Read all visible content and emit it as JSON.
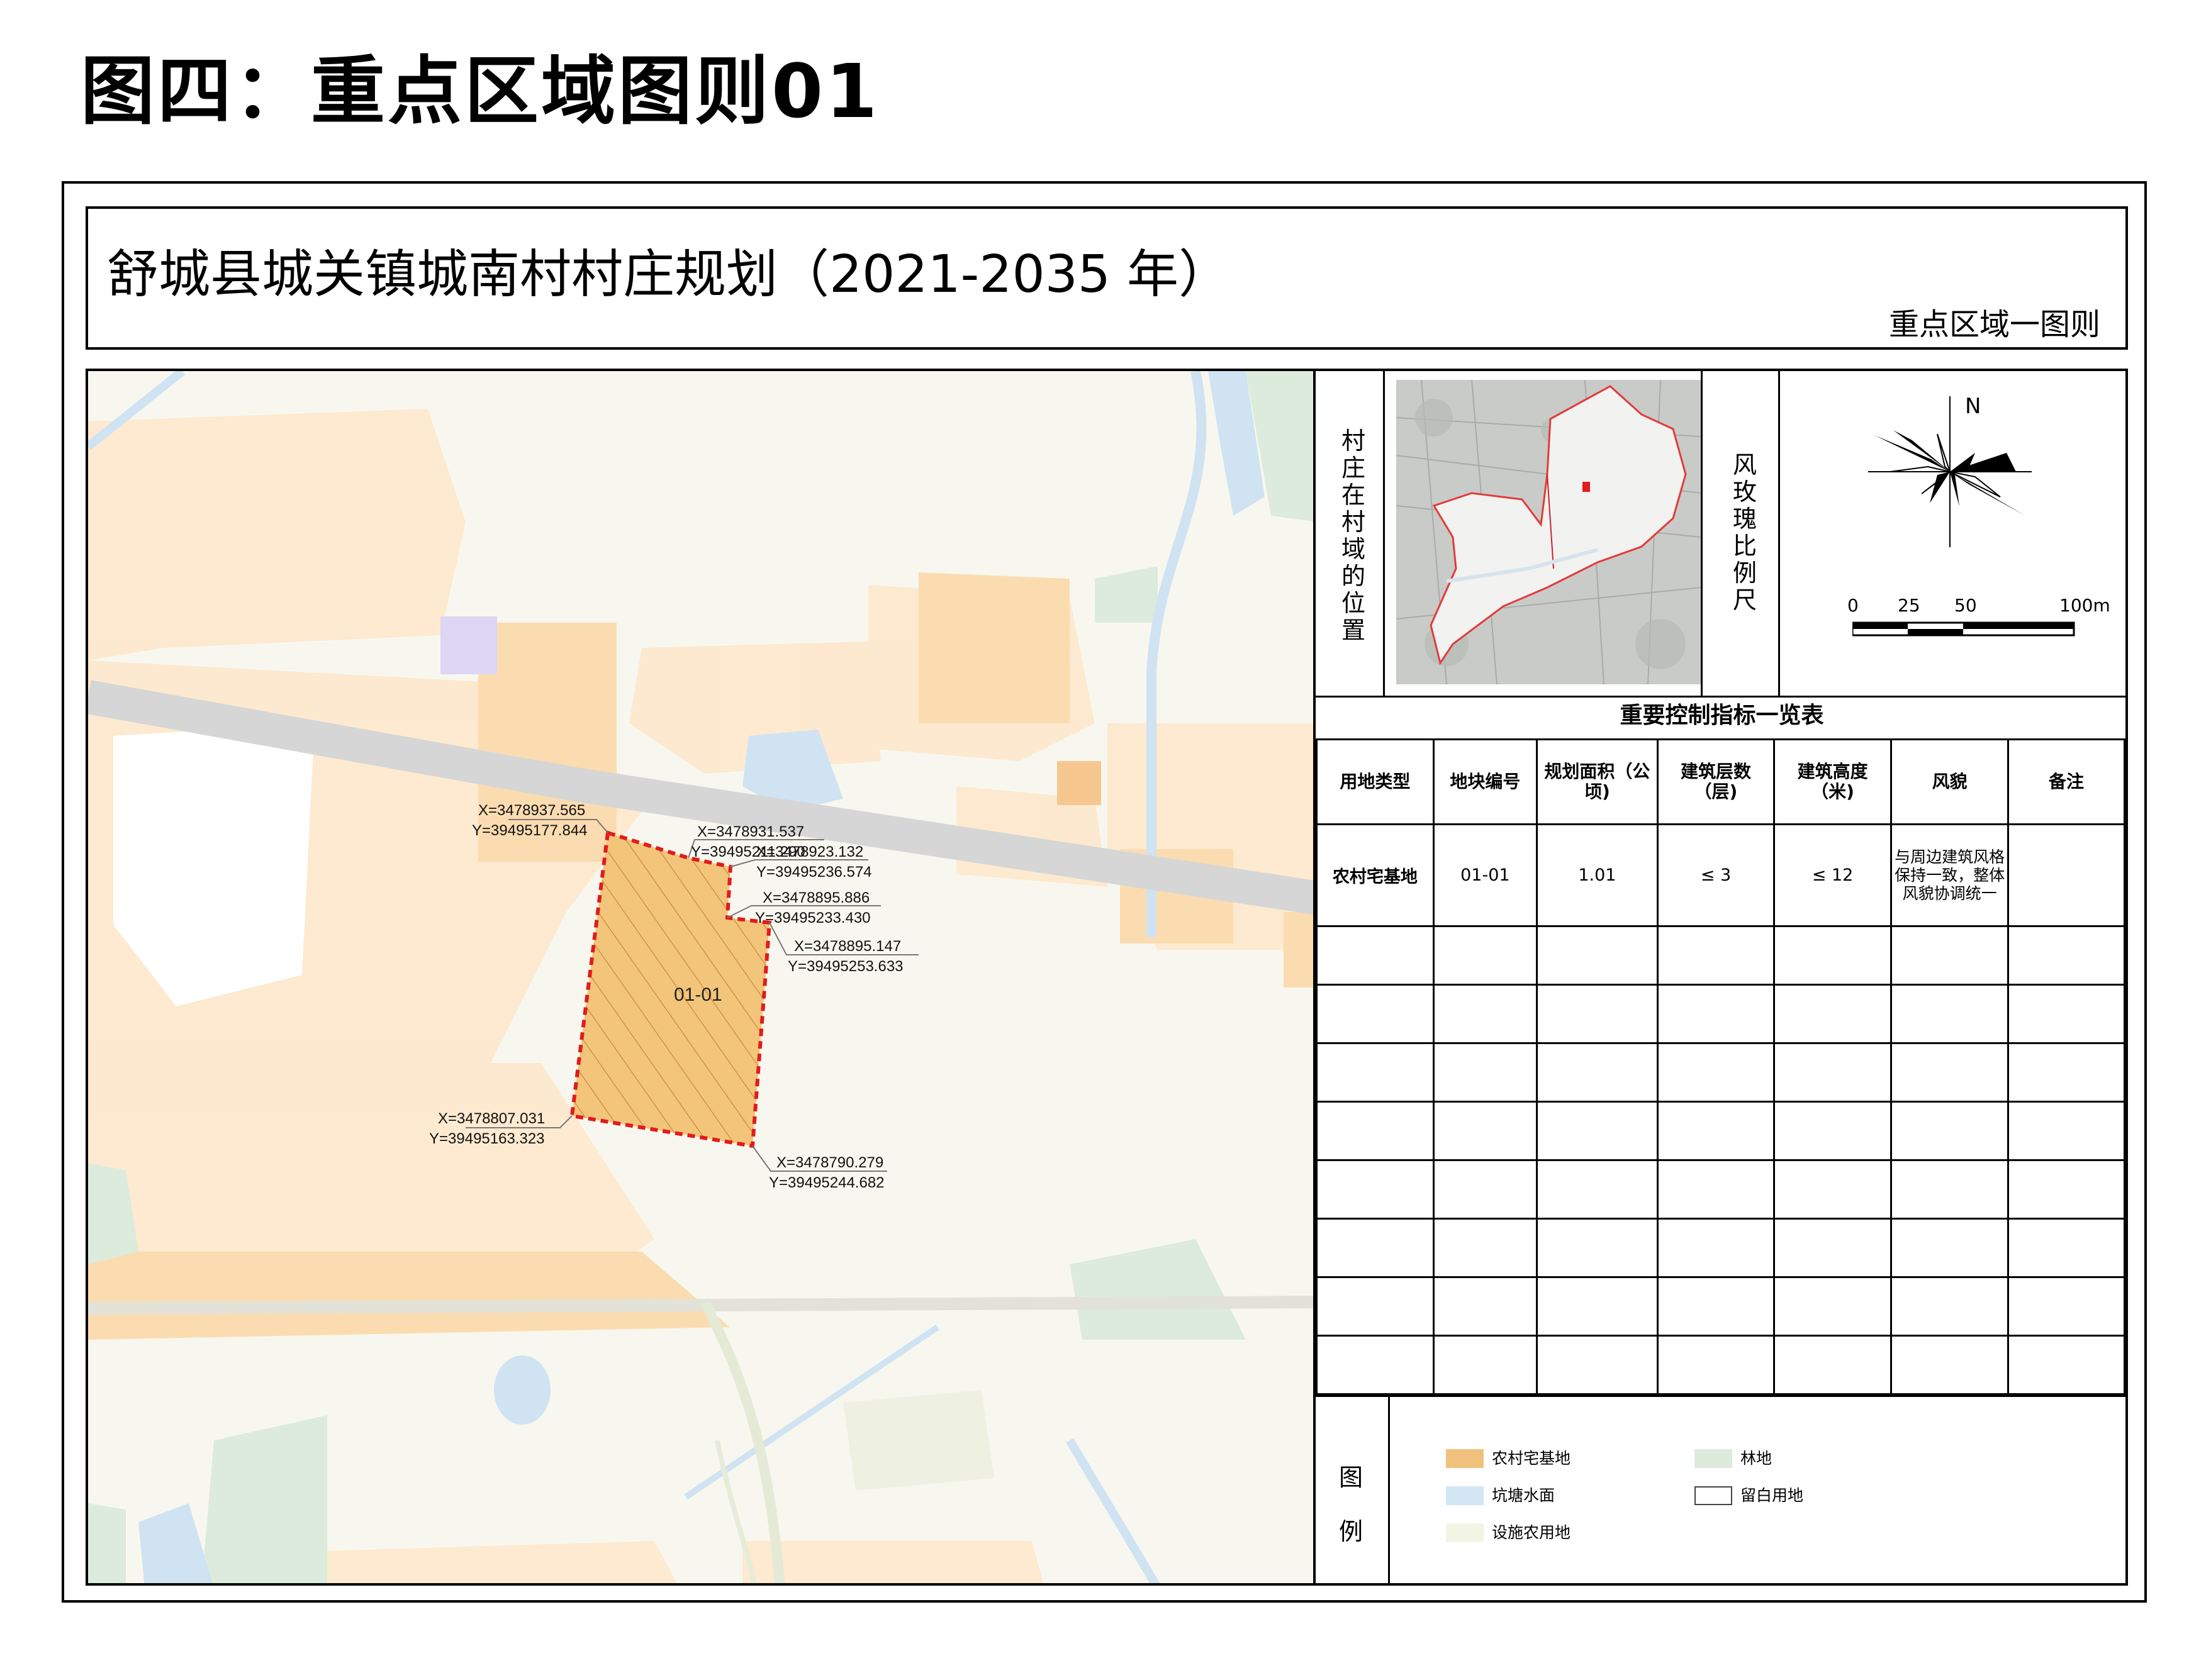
{
  "page_title": "图四：重点区域图则01",
  "header": {
    "plan_title": "舒城县城关镇城南村村庄规划（2021-2035 年）",
    "subtitle": "重点区域一图则"
  },
  "map": {
    "parcel_label": "01-01",
    "parcel_color": "#f3c57a",
    "boundary_color": "#e21b1b",
    "coordinates": [
      {
        "x_text": "X=3478937.565",
        "y_text": "Y=39495177.844"
      },
      {
        "x_text": "X=3478931.537",
        "y_text": "Y=39495211.290"
      },
      {
        "x_text": "X=3478923.132",
        "y_text": "Y=39495236.574"
      },
      {
        "x_text": "X=3478895.886",
        "y_text": "Y=39495233.430"
      },
      {
        "x_text": "X=3478895.147",
        "y_text": "Y=39495253.633"
      },
      {
        "x_text": "X=3478807.031",
        "y_text": "Y=39495163.323"
      },
      {
        "x_text": "X=3478790.279",
        "y_text": "Y=39495244.682"
      }
    ]
  },
  "side_panel": {
    "location_label": "村庄在村域的位置",
    "rose_label": "风玫瑰比例尺",
    "north_label": "N",
    "scale_labels": [
      "0",
      "25",
      "50",
      "100m"
    ],
    "scale_values_m": [
      0,
      25,
      50,
      100
    ]
  },
  "control_table": {
    "title": "重要控制指标一览表",
    "headers": [
      "用地类型",
      "地块编号",
      "规划面积（公顷)",
      "建筑层数（层)",
      "建筑高度（米)",
      "风貌",
      "备注"
    ],
    "rows": [
      [
        "农村宅基地",
        "01-01",
        "1.01",
        "≤ 3",
        "≤ 12",
        "与周边建筑风格保持一致，整体风貌协调统一",
        ""
      ]
    ],
    "empty_rows": 8
  },
  "legend": {
    "title": "图例",
    "items": [
      {
        "label": "农村宅基地",
        "color": "#f1c27d"
      },
      {
        "label": "林地",
        "color": "#dcebdc"
      },
      {
        "label": "坑塘水面",
        "color": "#d3e6f3"
      },
      {
        "label": "留白用地",
        "color": "#ffffff"
      },
      {
        "label": "设施农用地",
        "color": "#f3f5e4"
      }
    ]
  }
}
